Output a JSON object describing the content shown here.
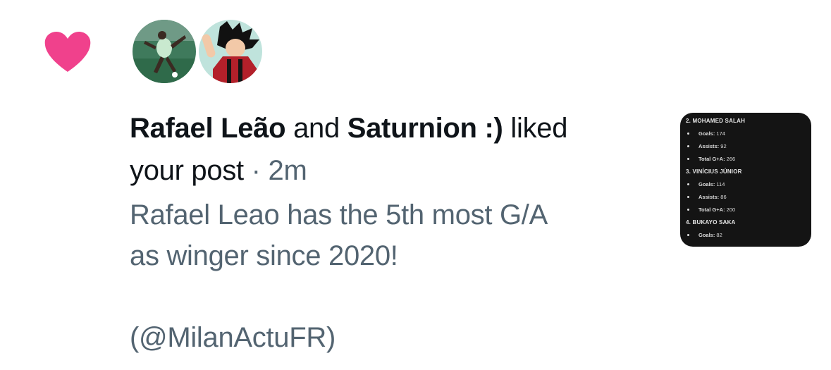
{
  "notification": {
    "actor_1": "Rafael Leão",
    "conjunction": "and",
    "actor_2": "Saturnion :)",
    "action_1": "liked",
    "action_2": "your post",
    "separator": "·",
    "time": "2m",
    "post_line_1": "Rafael Leao has the 5th most G/A",
    "post_line_2": "as winger since 2020!",
    "post_line_3": "(@MilanActuFR)",
    "heart_color": "#f91880"
  },
  "thumbnail": {
    "entries": [
      {
        "type": "player",
        "text": "2. MOHAMED SALAH"
      },
      {
        "type": "stat",
        "key": "Goals:",
        "value": "174"
      },
      {
        "type": "stat",
        "key": "Assists:",
        "value": "92"
      },
      {
        "type": "stat",
        "key": "Total G+A:",
        "value": "266"
      },
      {
        "type": "player",
        "text": "3. VINÍCIUS JÚNIOR"
      },
      {
        "type": "stat",
        "key": "Goals:",
        "value": "114"
      },
      {
        "type": "stat",
        "key": "Assists:",
        "value": "86"
      },
      {
        "type": "stat",
        "key": "Total G+A:",
        "value": "200"
      },
      {
        "type": "player",
        "text": "4. BUKAYO SAKA"
      },
      {
        "type": "stat",
        "key": "Goals:",
        "value": "82"
      }
    ]
  }
}
